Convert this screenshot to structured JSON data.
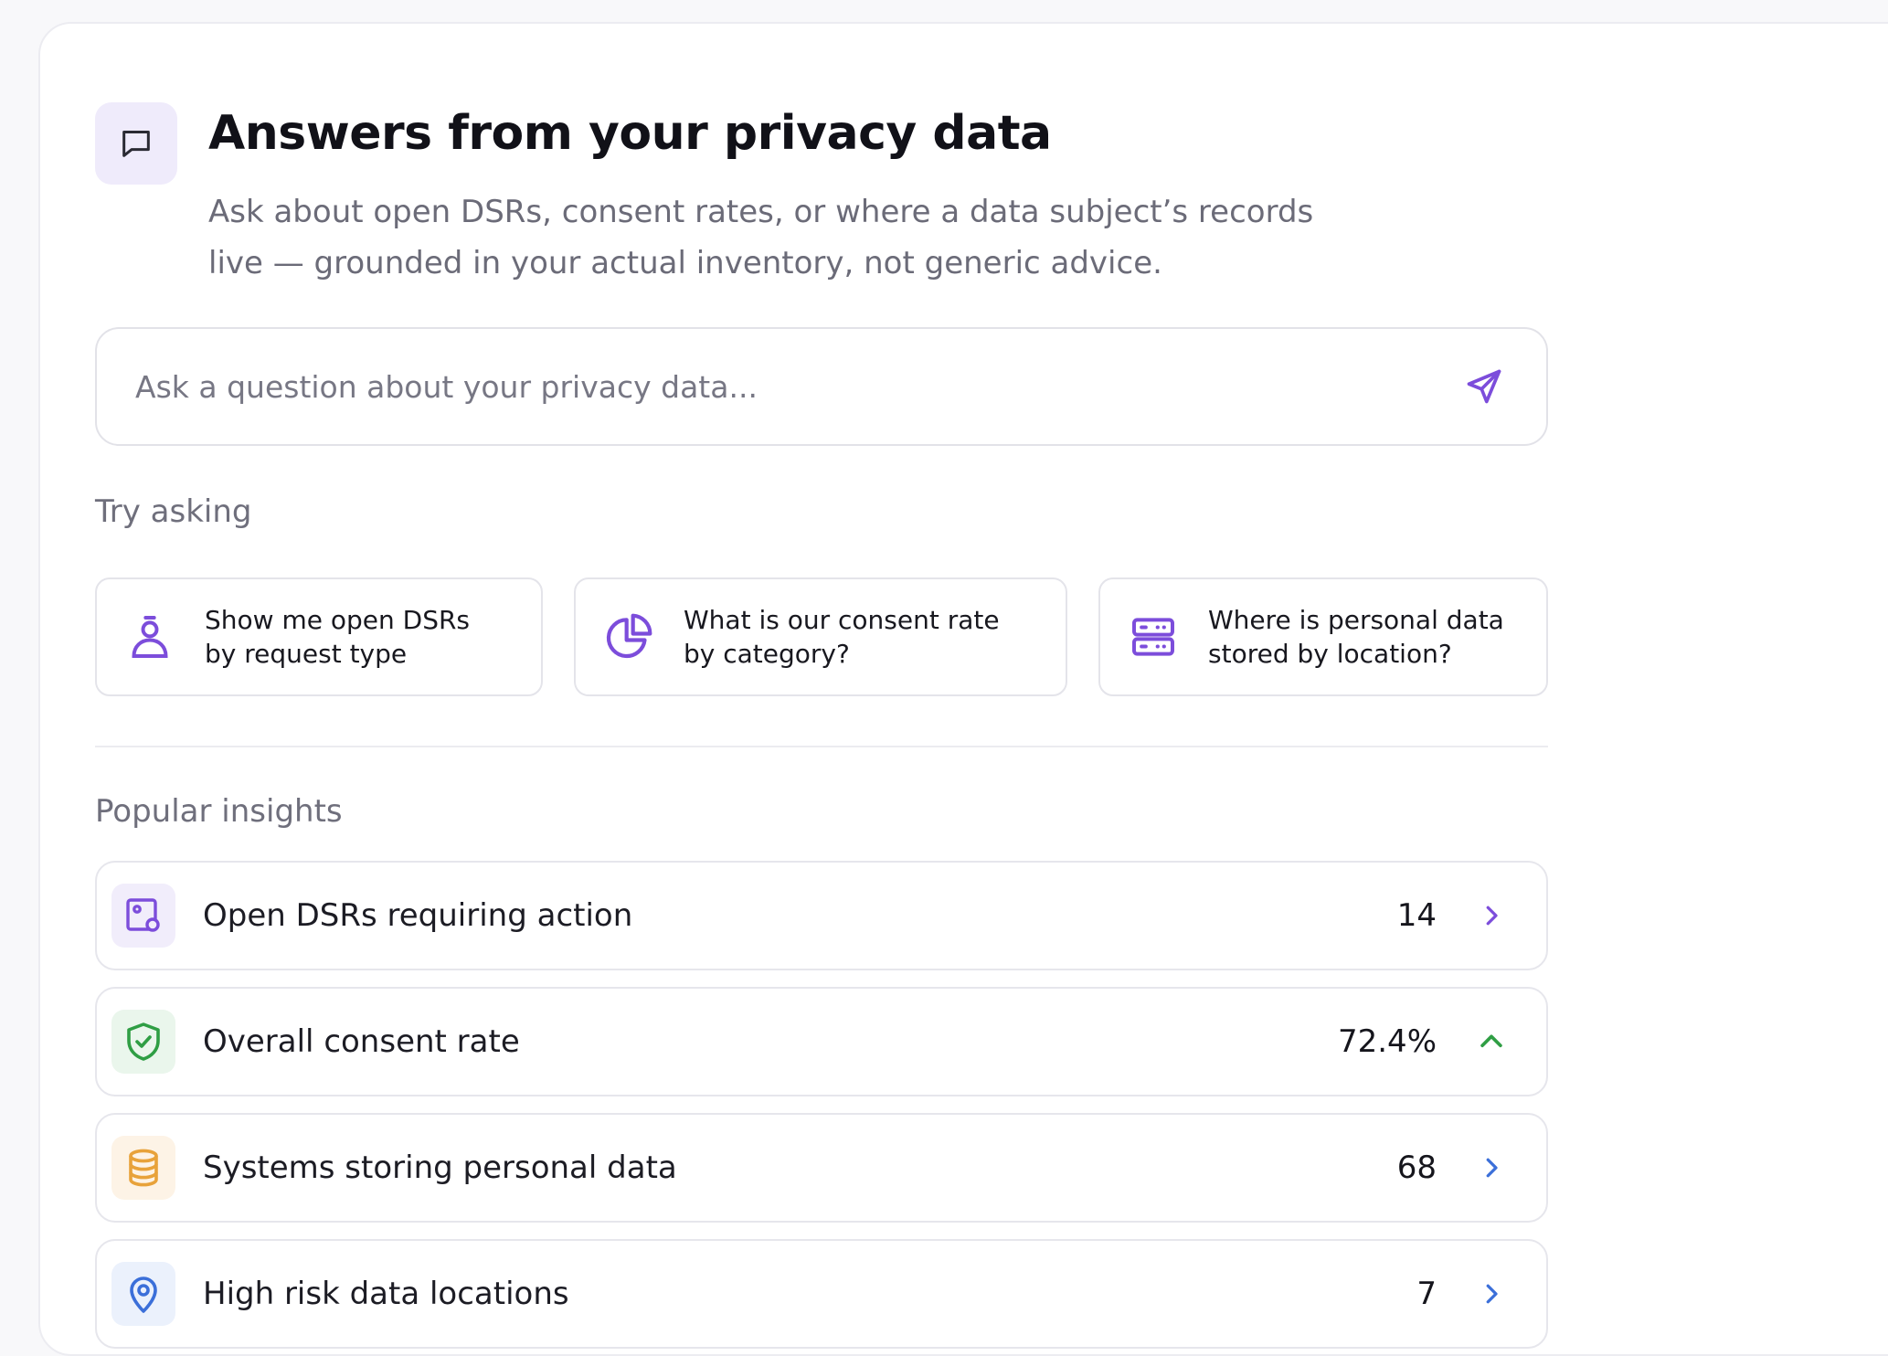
{
  "header": {
    "title": "Answers from your privacy data",
    "subtitle": "Ask about open DSRs, consent rates, or where a data subject’s records live — grounded in your actual inventory, not generic advice.",
    "icon": "chat-bubble-icon"
  },
  "ask": {
    "placeholder": "Ask a question about your privacy data...",
    "send_icon": "send-icon"
  },
  "suggestions": {
    "label": "Try asking",
    "items": [
      {
        "line1": "Show me open DSRs",
        "line2": "by request type",
        "icon": "person-icon"
      },
      {
        "line1": "What is our consent rate",
        "line2": "by category?",
        "icon": "pie-chart-icon"
      },
      {
        "line1": "Where is personal data",
        "line2": "stored by location?",
        "icon": "server-icon"
      }
    ]
  },
  "insights": {
    "label": "Popular insights",
    "items": [
      {
        "label": "Open DSRs requiring action",
        "value": "14",
        "icon": "request-file-icon",
        "trend": "chevron-right-icon"
      },
      {
        "label": "Overall consent rate",
        "value": "72.4%",
        "icon": "shield-check-icon",
        "trend": "chevron-up-icon"
      },
      {
        "label": "Systems storing personal data",
        "value": "68",
        "icon": "database-icon",
        "trend": "chevron-right-icon"
      },
      {
        "label": "High risk data locations",
        "value": "7",
        "icon": "location-pin-icon",
        "trend": "chevron-right-icon"
      }
    ]
  },
  "colors": {
    "accent": "#7c4ddb",
    "success": "#2f9e44",
    "warning": "#e8a23a",
    "info": "#3b6fd9"
  }
}
